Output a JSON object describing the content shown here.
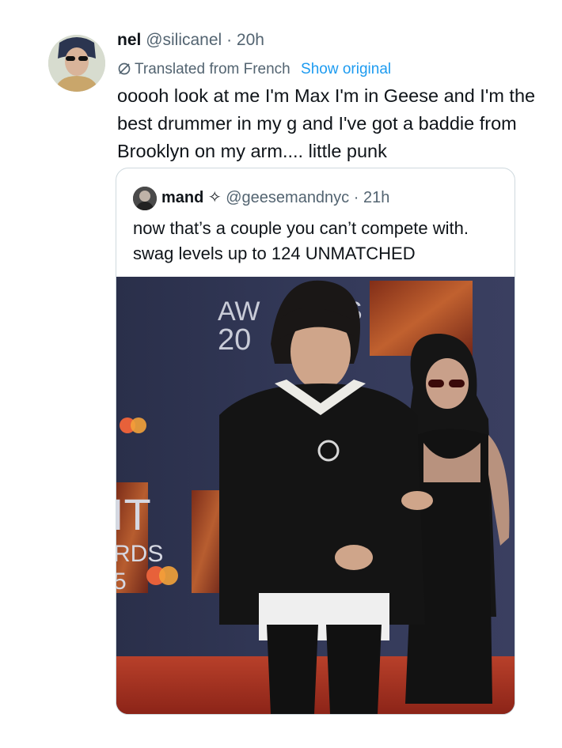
{
  "tweet": {
    "display_name": "nel",
    "handle": "@silicanel",
    "separator": "·",
    "time": "20h",
    "translated_label": "Translated from French",
    "show_original_label": "Show original",
    "text": "ooooh look at me I'm Max I'm in Geese and I'm the best drummer in my g and I've got a baddie from Brooklyn on my arm.... little punk"
  },
  "quote": {
    "display_name": "mand",
    "badge_glyph": "✧",
    "handle": "@geesemandnyc",
    "separator": "·",
    "time": "21h",
    "text": "now that’s a couple you can’t compete with. swag levels up to 124 UNMATCHED",
    "photo_sign_text": {
      "top": "AW",
      "top2": "S",
      "year": "20",
      "left_top": "IT",
      "left_mid": "RDS",
      "left_bottom": "5"
    }
  },
  "colors": {
    "text": "#0f1419",
    "muted": "#536471",
    "link": "#1d9bf0",
    "border": "#cfd9de"
  },
  "icons": {
    "translate": "translate-globe-icon",
    "badge": "sparkle-icon"
  }
}
